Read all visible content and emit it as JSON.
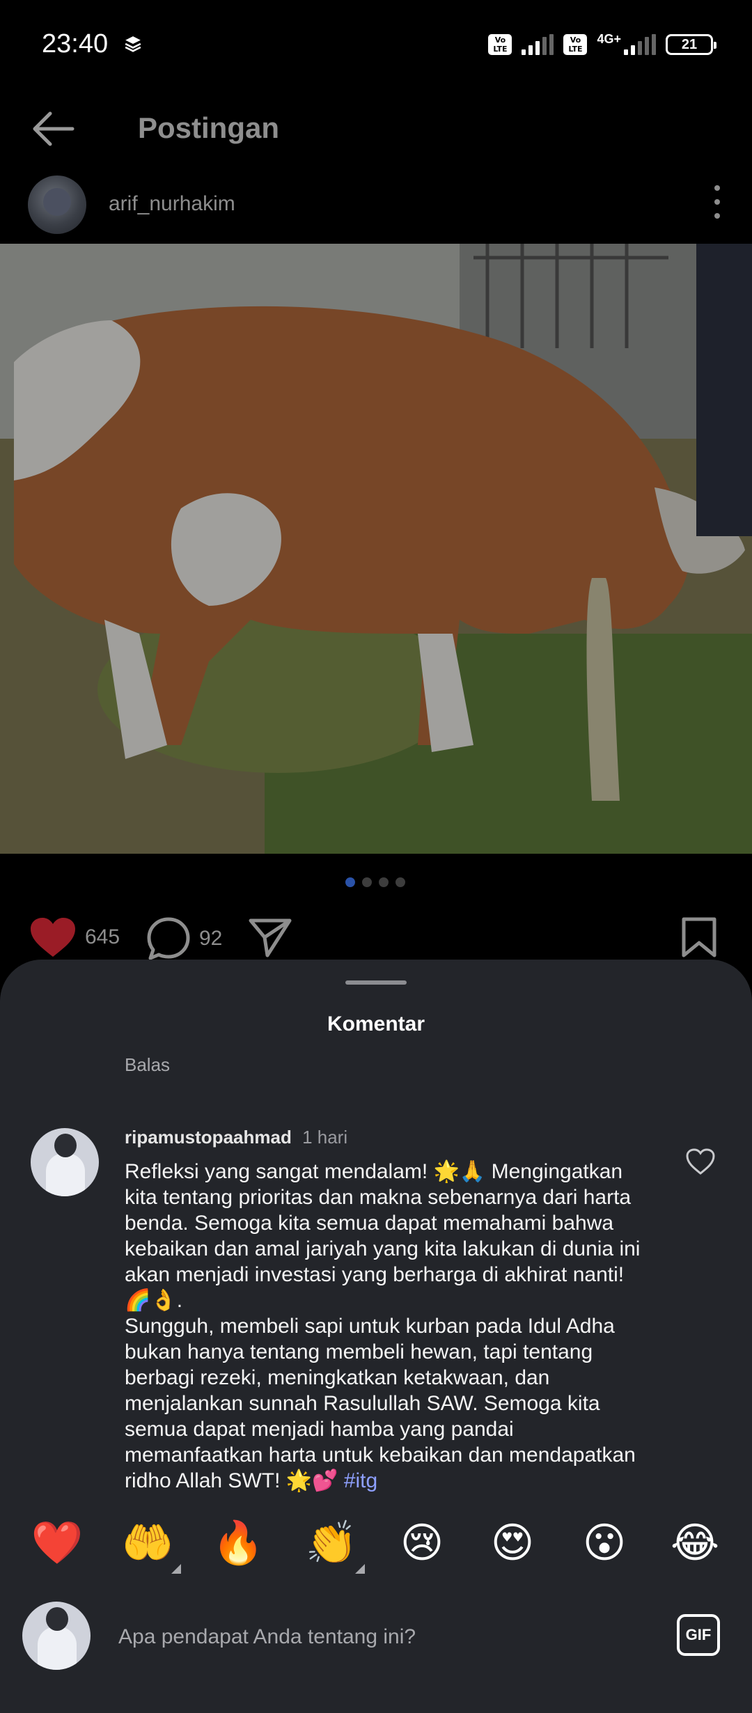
{
  "status_bar": {
    "time": "23:40",
    "volte_label": "Vo\nLTE",
    "network_label": "4G+",
    "battery": "21",
    "icons": [
      "layers-icon",
      "volte-icon",
      "signal-icon",
      "battery-icon"
    ]
  },
  "header": {
    "title": "Postingan",
    "back_icon": "back-arrow-icon"
  },
  "post": {
    "author": "arif_nurhakim",
    "menu_icon": "more-vertical-icon",
    "carousel": {
      "total": 4,
      "active_index": 0
    },
    "likes": "645",
    "comments": "92",
    "icons": [
      "heart-icon",
      "comment-icon",
      "share-icon",
      "bookmark-icon"
    ],
    "like_color": "#c0202c"
  },
  "comments_sheet": {
    "title": "Komentar",
    "reply_label": "Balas",
    "comment": {
      "username": "ripamustopaahmad",
      "time": "1 hari",
      "text": "Refleksi yang sangat mendalam! 🌟🙏 Mengingatkan kita tentang prioritas dan makna sebenarnya dari harta benda. Semoga kita semua dapat memahami bahwa kebaikan dan amal jariyah yang kita lakukan di dunia ini akan menjadi investasi yang berharga di akhirat nanti! 🌈👌.\nSungguh, membeli sapi untuk kurban pada Idul Adha bukan hanya tentang membeli hewan, tapi tentang berbagi rezeki, meningkatkan ketakwaan, dan menjalankan sunnah Rasulullah SAW. Semoga kita semua dapat menjadi hamba yang pandai memanfaatkan harta untuk kebaikan dan mendapatkan ridho Allah SWT! 🌟💕",
      "hashtag": "#itg"
    },
    "reactions": [
      "❤️",
      "🤲",
      "🔥",
      "👏",
      "😢",
      "😍",
      "😮",
      "😂"
    ],
    "compose": {
      "placeholder": "Apa pendapat Anda tentang ini?",
      "gif_label": "GIF"
    }
  }
}
